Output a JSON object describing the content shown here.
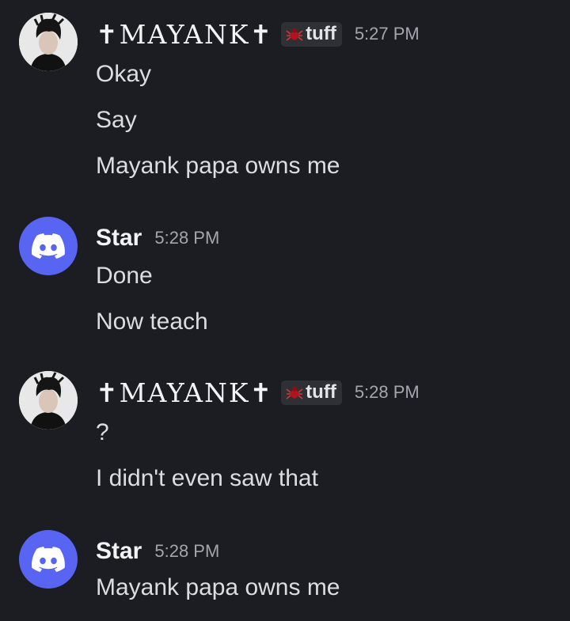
{
  "messages": [
    {
      "author": "✝MAYANK✝",
      "tag": "tuff",
      "time": "5:27 PM",
      "lines": [
        "Okay",
        "Say",
        "Mayank papa owns me"
      ]
    },
    {
      "author": "Star",
      "time": "5:28 PM",
      "lines": [
        "Done",
        "Now teach"
      ]
    },
    {
      "author": "✝MAYANK✝",
      "tag": "tuff",
      "time": "5:28 PM",
      "lines": [
        "?",
        "I didn't even saw that"
      ]
    },
    {
      "author": "Star",
      "time": "5:28 PM",
      "lines": [
        "Mayank papa owns me"
      ]
    }
  ],
  "icons": {
    "tag_icon": "spider-icon",
    "bot_avatar": "discord-logo-icon",
    "user_avatar": "user-photo-avatar"
  },
  "colors": {
    "background": "#1c1d22",
    "discord_blurple": "#5865f2",
    "timestamp": "#a3a6ad",
    "tag_background": "#2e3036"
  }
}
